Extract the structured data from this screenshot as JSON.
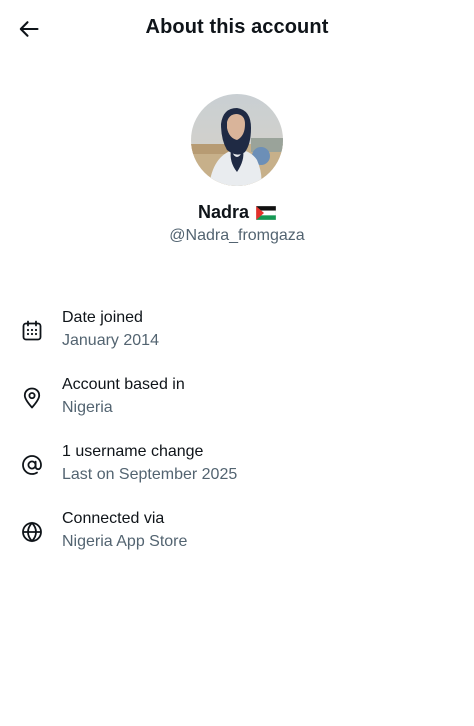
{
  "header": {
    "back_icon": "arrow-left-icon",
    "title": "About this account"
  },
  "profile": {
    "name": "Nadra",
    "flag": "palestine-flag",
    "handle": "@Nadra_fromgaza"
  },
  "details": [
    {
      "icon": "calendar-icon",
      "title": "Date joined",
      "value": "January 2014"
    },
    {
      "icon": "location-pin-icon",
      "title": "Account based in",
      "value": "Nigeria"
    },
    {
      "icon": "at-sign-icon",
      "title": "1 username change",
      "value": "Last on September 2025"
    },
    {
      "icon": "globe-icon",
      "title": "Connected via",
      "value": "Nigeria App Store"
    }
  ],
  "colors": {
    "primary_text": "#0f1419",
    "secondary_text": "#536471",
    "background": "#ffffff"
  }
}
